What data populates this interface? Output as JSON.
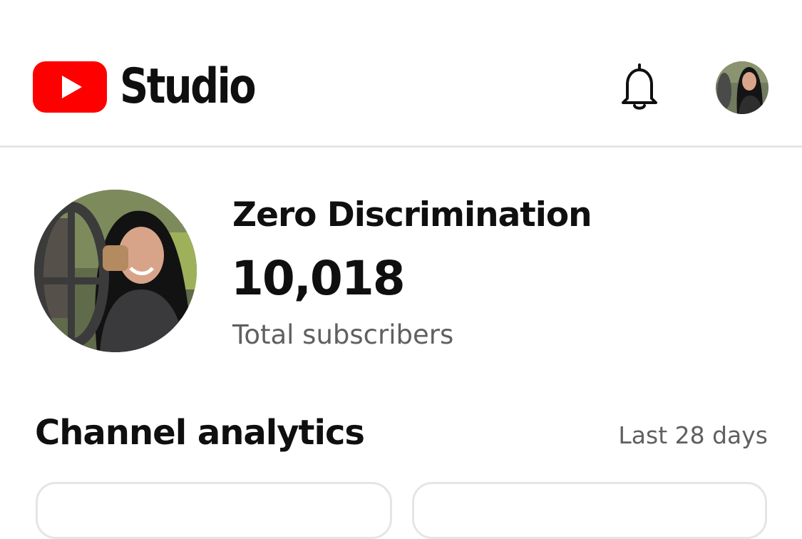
{
  "header": {
    "app_name": "Studio",
    "logo_icon": "youtube-play-icon",
    "notification_icon": "bell-icon",
    "brand_color": "#ff0000"
  },
  "channel": {
    "name": "Zero Discrimination",
    "subscriber_count": "10,018",
    "subscriber_label": "Total subscribers"
  },
  "analytics": {
    "title": "Channel analytics",
    "period": "Last 28 days"
  }
}
